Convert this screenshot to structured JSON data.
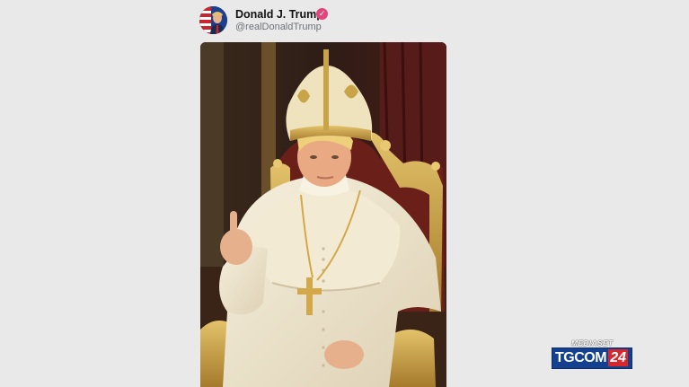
{
  "post": {
    "author": "Donald J. Trump",
    "handle": "@realDonaldTrump",
    "verified_icon": "verified-check-icon"
  },
  "image": {
    "subject": "figure in white papal vestments and gold mitre seated on a gilded throne, raising one finger",
    "icon": "post-image"
  },
  "watermark": {
    "network": "MEDIASET",
    "channel": "TGCOM",
    "channel_number": "24"
  },
  "colors": {
    "background": "#e9e9e9",
    "verified": "#e0457b",
    "watermark_blue": "#14418f",
    "watermark_red": "#d7262c"
  }
}
